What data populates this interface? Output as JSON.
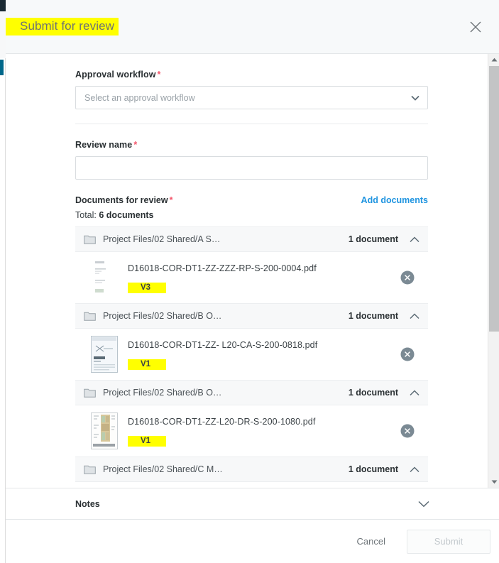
{
  "header": {
    "title": "Submit for review",
    "close_icon": "close-icon"
  },
  "form": {
    "approval_workflow": {
      "label": "Approval workflow",
      "required_marker": "*",
      "placeholder": "Select an approval workflow",
      "value": "",
      "chevron_icon": "chevron-down-icon"
    },
    "review_name": {
      "label": "Review name",
      "required_marker": "*",
      "placeholder": "",
      "value": ""
    }
  },
  "documents": {
    "label": "Documents for review",
    "required_marker": "*",
    "add_link": "Add documents",
    "total_prefix": "Total:",
    "total_value": "6 documents",
    "groups": [
      {
        "folder": "Project Files/02 Shared/A S…",
        "count": "1 document",
        "collapse_icon": "chevron-up-icon",
        "files": [
          {
            "name": "D16018-COR-DT1-ZZ-ZZZ-RP-S-200-0004.pdf",
            "version": "V3",
            "thumbnail": "text-document-thumbnail",
            "remove_icon": "remove-circle-icon"
          }
        ]
      },
      {
        "folder": "Project Files/02 Shared/B O…",
        "count": "1 document",
        "collapse_icon": "chevron-up-icon",
        "files": [
          {
            "name": "D16018-COR-DT1-ZZ- L20-CA-S-200-0818.pdf",
            "version": "V1",
            "thumbnail": "chart-document-thumbnail",
            "remove_icon": "remove-circle-icon"
          }
        ]
      },
      {
        "folder": "Project Files/02 Shared/B O…",
        "count": "1 document",
        "collapse_icon": "chevron-up-icon",
        "files": [
          {
            "name": "D16018-COR-DT1-ZZ-L20-DR-S-200-1080.pdf",
            "version": "V1",
            "thumbnail": "drawing-document-thumbnail",
            "remove_icon": "remove-circle-icon"
          }
        ]
      },
      {
        "folder": "Project Files/02 Shared/C M…",
        "count": "1 document",
        "collapse_icon": "chevron-up-icon",
        "files": []
      }
    ]
  },
  "notes": {
    "label": "Notes",
    "expand_icon": "chevron-down-icon"
  },
  "footer": {
    "cancel_label": "Cancel",
    "submit_label": "Submit",
    "submit_disabled": true
  },
  "colors": {
    "accent_link": "#1f94e0",
    "required": "#f4566b",
    "highlight": "#ffff00",
    "rail_accent": "#00678a",
    "header_bg": "#f7f9fa"
  }
}
